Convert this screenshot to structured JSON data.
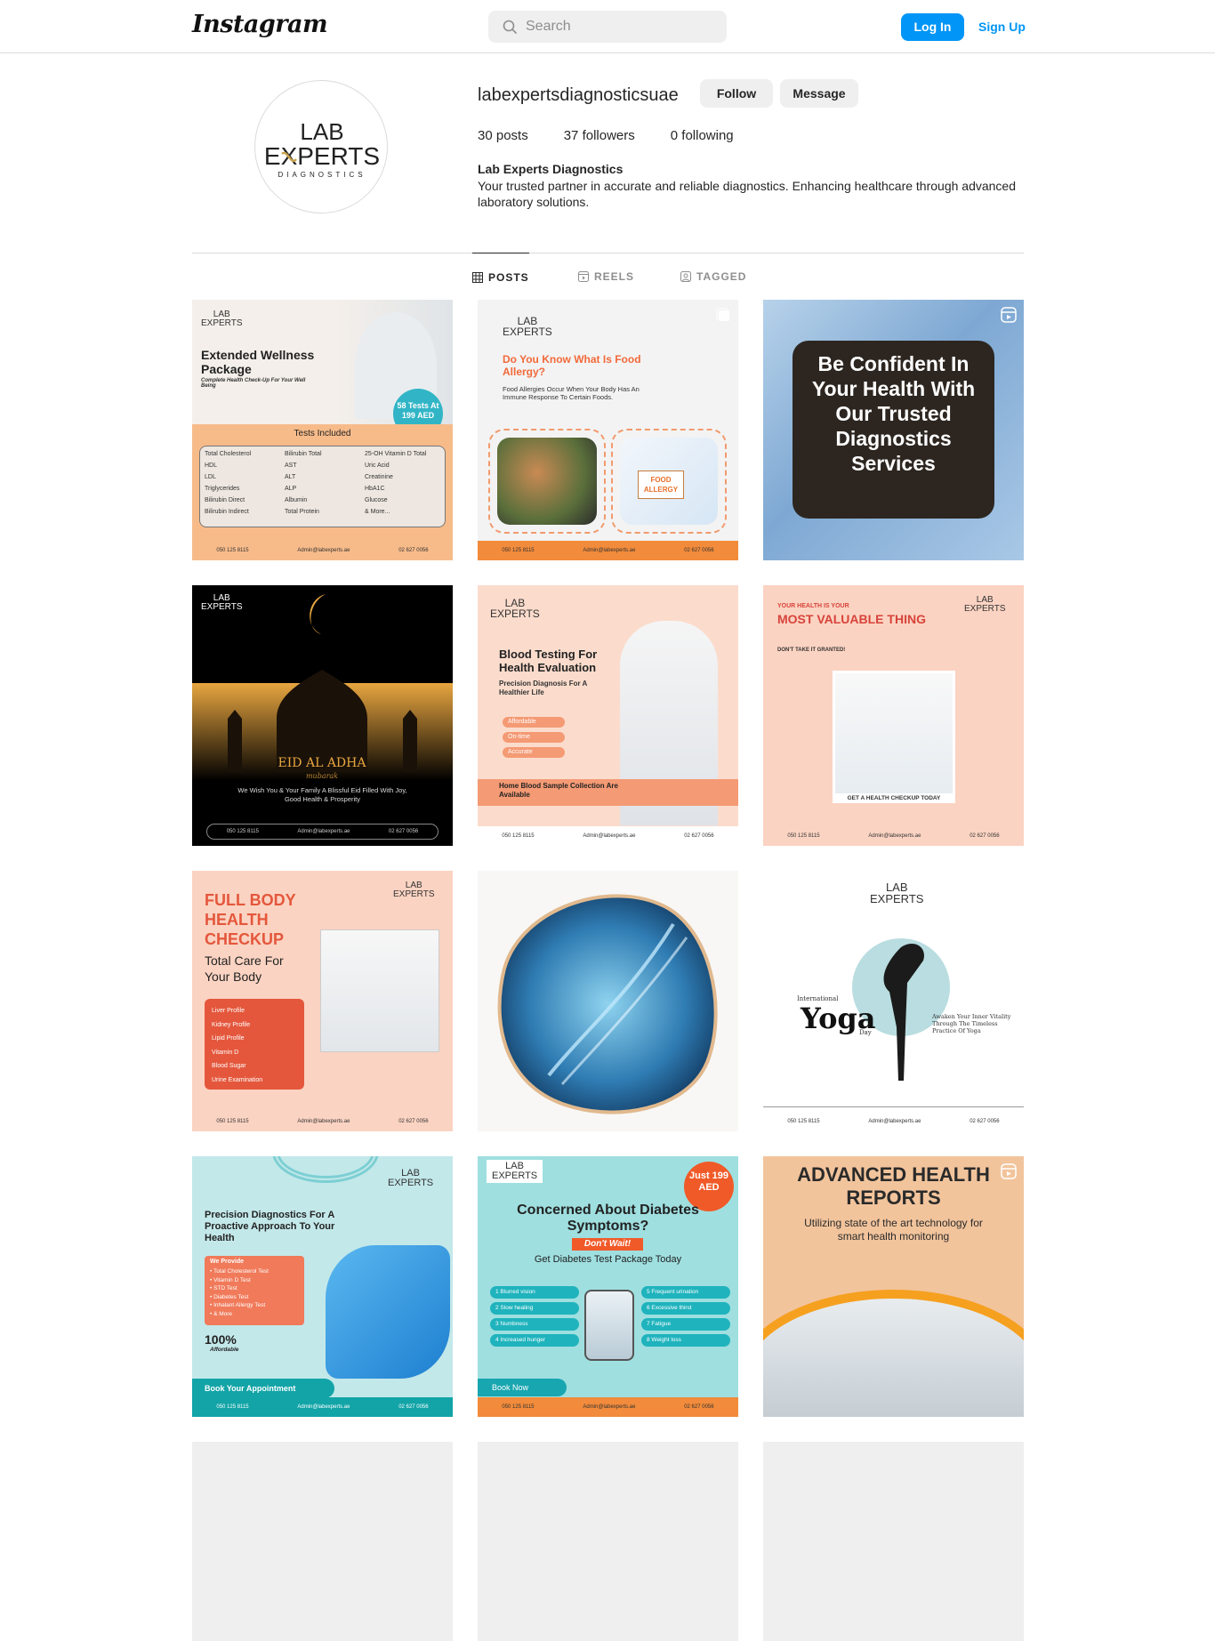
{
  "topbar": {
    "logo": "Instagram",
    "search_placeholder": "Search",
    "login_label": "Log In",
    "signup_label": "Sign Up"
  },
  "profile": {
    "username": "labexpertsdiagnosticsuae",
    "follow_label": "Follow",
    "message_label": "Message",
    "posts": "30 posts",
    "followers": "37 followers",
    "following": "0 following",
    "display_name": "Lab Experts Diagnostics",
    "bio": "Your trusted partner in accurate and reliable diagnostics. Enhancing healthcare through advanced laboratory solutions.",
    "avatar_logo": {
      "line1": "LAB",
      "line2": "EXPERTS",
      "line3": "DIAGNOSTICS"
    }
  },
  "tabs": [
    {
      "label": "POSTS",
      "icon": "grid-icon",
      "active": true
    },
    {
      "label": "REELS",
      "icon": "reels-icon",
      "active": false
    },
    {
      "label": "TAGGED",
      "icon": "tagged-icon",
      "active": false
    }
  ],
  "posts": [
    {
      "title": "Extended Wellness Package",
      "subtitle": "Complete Health Check-Up For Your Well Being",
      "badge": "58 Tests At 199 AED",
      "section": "Tests Included",
      "tests": [
        "Total Cholesterol",
        "HDL",
        "LDL",
        "Triglycerides",
        "Bilirubin Direct",
        "Bilirubin Indirect",
        "Bilirubin Total",
        "AST",
        "ALT",
        "ALP",
        "Albumin",
        "Total Protein",
        "25-OH Vitamin D Total",
        "Uric Acid",
        "Creatinine",
        "HbA1C",
        "Glucose",
        "& More..."
      ]
    },
    {
      "title": "Do You Know What Is Food Allergy?",
      "text": "Food Allergies Occur When Your Body Has An Immune Response To Certain Foods.",
      "tag": "FOOD ALLERGY"
    },
    {
      "text": "Be Confident In Your Health With Our Trusted Diagnostics Services",
      "highlight": "Trusted Diagnostics Services"
    },
    {
      "title": "EID AL ADHA",
      "subtitle": "mubarak",
      "text": "We Wish You & Your Family A Blissful Eid Filled With Joy, Good Health & Prosperity"
    },
    {
      "title": "Blood Testing For Health Evaluation",
      "subtitle": "Precision Diagnosis For A Healthier Life",
      "chips": [
        "Affordable",
        "On-time",
        "Accurate"
      ],
      "footer": "Home Blood Sample Collection Are Available"
    },
    {
      "kicker": "YOUR HEALTH IS YOUR",
      "title": "MOST VALUABLE THING",
      "subtitle": "DON'T TAKE IT GRANTED!",
      "cta": "GET A HEALTH CHECKUP TODAY"
    },
    {
      "title": "FULL BODY HEALTH CHECKUP",
      "subtitle": "Total Care For Your Body",
      "items": [
        "Liver Profile",
        "Kidney Profile",
        "Lipid Profile",
        "Vitamin D",
        "Blood Sugar",
        "Urine Examination"
      ]
    },
    {
      "alt": "dna-image"
    },
    {
      "kicker": "International",
      "title": "Yoga",
      "small": "Day",
      "quote": "Awaken Your Inner Vitality Through The Timeless Practice Of Yoga"
    },
    {
      "title": "Precision Diagnostics For A Proactive Approach To Your Health",
      "box_title": "We Provide",
      "items": [
        "Total Cholesterol Test",
        "Vitamin D Test",
        "STD Test",
        "Diabetes Test",
        "Inhalant Allergy Test",
        "& More"
      ],
      "stat": "100%",
      "stat_label": "Affordable",
      "cta": "Book Your Appointment"
    },
    {
      "title": "Concerned About Diabetes Symptoms?",
      "banner": "Don't Wait!",
      "subtitle": "Get Diabetes Test Package Today",
      "badge": "Just 199 AED",
      "symptoms": [
        "Blurred vision",
        "Slow healing",
        "Numbness",
        "Increased hunger",
        "Frequent urination",
        "Excessive thirst",
        "Fatigue",
        "Weight loss"
      ],
      "cta": "Book Now"
    },
    {
      "title": "ADVANCED HEALTH REPORTS",
      "subtitle": "Utilizing state of the art technology for smart health monitoring"
    }
  ],
  "contact": {
    "phone": "050 125 8115",
    "email": "Admin@labexperts.ae",
    "tel": "02 627 0056"
  },
  "colors": {
    "accent": "#0095f6",
    "peach": "#f9c9b4",
    "orange": "#f26a3a",
    "teal": "#62c6c9",
    "dark": "#2d2620"
  }
}
